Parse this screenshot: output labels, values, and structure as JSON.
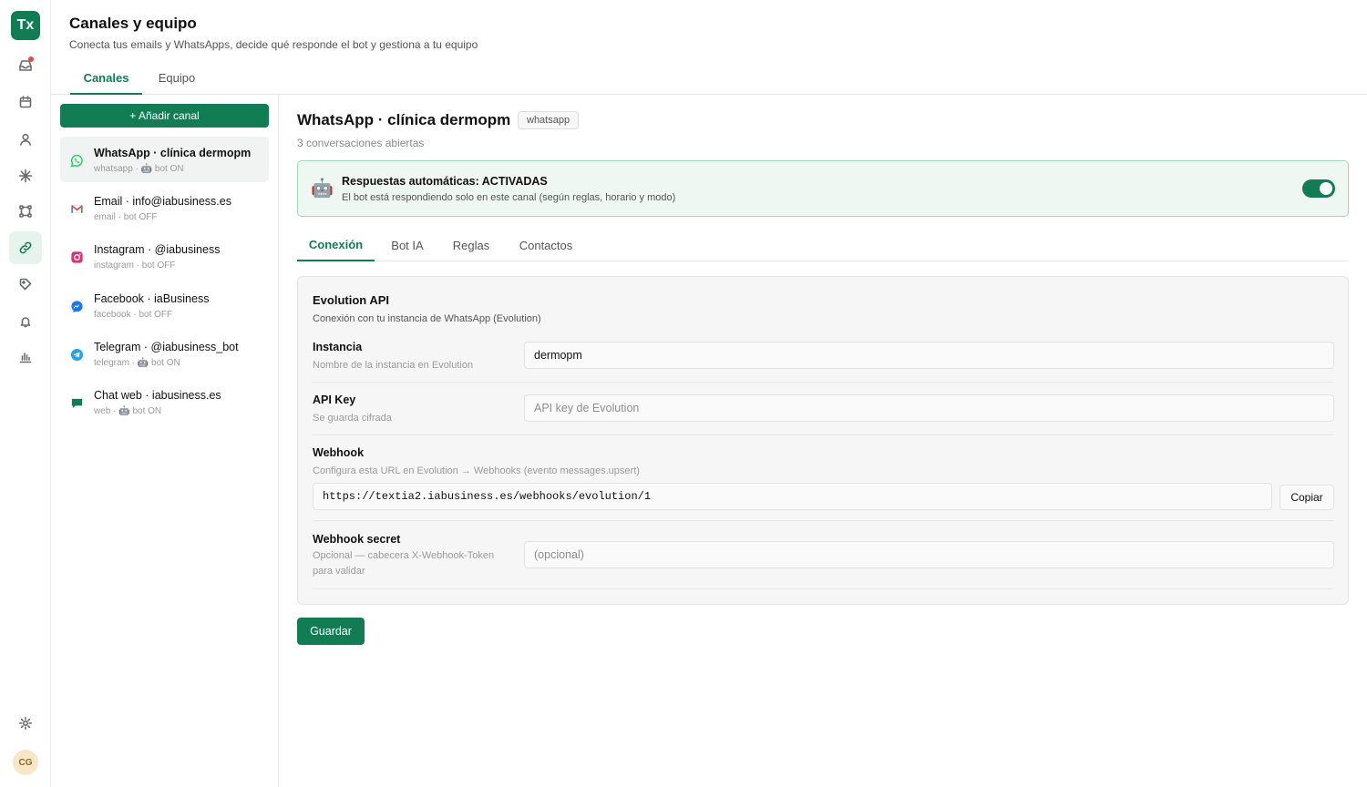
{
  "app": {
    "logo": "Tx",
    "user_initials": "CG"
  },
  "rail": {
    "items": [
      {
        "icon": "inbox-icon",
        "active": false,
        "has_dot": true
      },
      {
        "icon": "calendar-icon",
        "active": false
      },
      {
        "icon": "user-icon",
        "active": false
      },
      {
        "icon": "sparkle-icon",
        "active": false
      },
      {
        "icon": "flow-icon",
        "active": false
      },
      {
        "icon": "link-icon",
        "active": true
      },
      {
        "icon": "tag-icon",
        "active": false
      },
      {
        "icon": "bell-icon",
        "active": false
      },
      {
        "icon": "chart-icon",
        "active": false
      }
    ],
    "bottom": {
      "icon": "gear-icon"
    }
  },
  "header": {
    "title": "Canales y equipo",
    "subtitle": "Conecta tus emails y WhatsApps, decide qué responde el bot y gestiona a tu equipo",
    "tabs": [
      {
        "label": "Canales",
        "active": true
      },
      {
        "label": "Equipo",
        "active": false
      }
    ]
  },
  "channels": {
    "add_label": "+ Añadir canal",
    "items": [
      {
        "name": "WhatsApp · clínica dermopm",
        "meta": "whatsapp · 🤖 bot ON",
        "icon": "whatsapp-icon",
        "color": "#25d366",
        "active": true
      },
      {
        "name": "Email · info@iabusiness.es",
        "meta": "email · bot OFF",
        "icon": "mail-icon",
        "color": "#ea4335",
        "active": false
      },
      {
        "name": "Instagram · @iabusiness",
        "meta": "instagram · bot OFF",
        "icon": "instagram-icon",
        "color": "#e1306c",
        "active": false
      },
      {
        "name": "Facebook · iaBusiness",
        "meta": "facebook · bot OFF",
        "icon": "messenger-icon",
        "color": "#1877f2",
        "active": false
      },
      {
        "name": "Telegram · @iabusiness_bot",
        "meta": "telegram · 🤖 bot ON",
        "icon": "telegram-icon",
        "color": "#2aa3df",
        "active": false
      },
      {
        "name": "Chat web · iabusiness.es",
        "meta": "web · 🤖 bot ON",
        "icon": "chat-icon",
        "color": "#127c55",
        "active": false
      }
    ]
  },
  "detail": {
    "title": "WhatsApp · clínica dermopm",
    "type_badge": "whatsapp",
    "subtitle": "3 conversaciones abiertas",
    "auto": {
      "icon": "🤖",
      "title": "Respuestas automáticas: ACTIVADAS",
      "description": "El bot está respondiendo solo en este canal (según reglas, horario y modo)",
      "enabled": true
    },
    "tabs": [
      {
        "label": "Conexión",
        "active": true
      },
      {
        "label": "Bot IA",
        "active": false
      },
      {
        "label": "Reglas",
        "active": false
      },
      {
        "label": "Contactos",
        "active": false
      }
    ],
    "panel": {
      "title": "Evolution API",
      "subtitle": "Conexión con tu instancia de WhatsApp (Evolution)",
      "fields": {
        "instance": {
          "label": "Instancia",
          "help": "Nombre de la instancia en Evolution",
          "value": "dermopm",
          "placeholder": ""
        },
        "api_key": {
          "label": "API Key",
          "help": "Se guarda cifrada",
          "value": "",
          "placeholder": "API key de Evolution"
        },
        "webhook": {
          "label": "Webhook",
          "help": "Configura esta URL en Evolution → Webhooks (evento messages.upsert)",
          "value": "https://textia2.iabusiness.es/webhooks/evolution/1",
          "copy_label": "Copiar"
        },
        "secret": {
          "label": "Webhook secret",
          "help_line1": "Opcional — cabecera X-Webhook-Token",
          "help_line2": "para validar",
          "value": "",
          "placeholder": "(opcional)"
        }
      }
    },
    "save_label": "Guardar"
  },
  "colors": {
    "accent": "#127c55",
    "accent_light": "#eef7f2",
    "notification": "#e5484d"
  }
}
